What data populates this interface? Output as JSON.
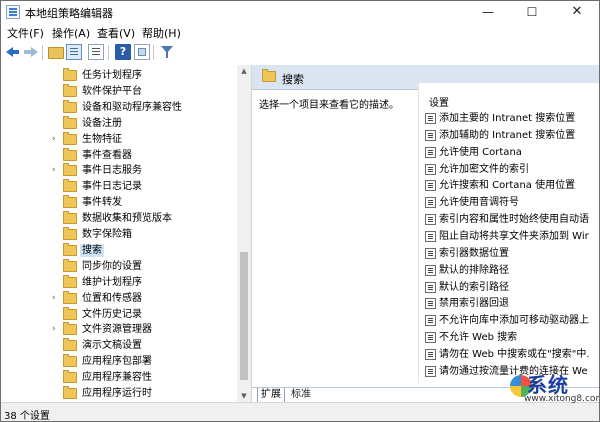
{
  "window": {
    "title": "本地组策略编辑器",
    "min_glyph": "—",
    "max_glyph": "☐",
    "close_glyph": "✕"
  },
  "menu": [
    "文件(F)",
    "操作(A)",
    "查看(V)",
    "帮助(H)"
  ],
  "toolbar": {
    "icons": [
      "back-arrow-icon",
      "forward-arrow-icon",
      "folder-up-icon",
      "show-hide-tree-icon",
      "list-icon",
      "help-icon",
      "properties-icon",
      "filter-icon"
    ],
    "help_glyph": "?"
  },
  "tree": {
    "items": [
      {
        "label": "任务计划程序",
        "expandable": false
      },
      {
        "label": "软件保护平台",
        "expandable": false
      },
      {
        "label": "设备和驱动程序兼容性",
        "expandable": false
      },
      {
        "label": "设备注册",
        "expandable": false
      },
      {
        "label": "生物特征",
        "expandable": true
      },
      {
        "label": "事件查看器",
        "expandable": false
      },
      {
        "label": "事件日志服务",
        "expandable": true
      },
      {
        "label": "事件日志记录",
        "expandable": false
      },
      {
        "label": "事件转发",
        "expandable": false
      },
      {
        "label": "数据收集和预览版本",
        "expandable": false
      },
      {
        "label": "数字保险箱",
        "expandable": false
      },
      {
        "label": "搜索",
        "expandable": false,
        "selected": true
      },
      {
        "label": "同步你的设置",
        "expandable": false
      },
      {
        "label": "维护计划程序",
        "expandable": false
      },
      {
        "label": "位置和传感器",
        "expandable": true
      },
      {
        "label": "文件历史记录",
        "expandable": false
      },
      {
        "label": "文件资源管理器",
        "expandable": true
      },
      {
        "label": "演示文稿设置",
        "expandable": false
      },
      {
        "label": "应用程序包部署",
        "expandable": false
      },
      {
        "label": "应用程序兼容性",
        "expandable": false
      },
      {
        "label": "应用程序运行时",
        "expandable": false
      }
    ],
    "expand_glyph": "›",
    "scroll_up_glyph": "▲",
    "scroll_down_glyph": "▼"
  },
  "detail": {
    "header_title": "搜索",
    "description": "选择一个项目来查看它的描述。",
    "settings_header": "设置",
    "settings": [
      "添加主要的 Intranet 搜索位置",
      "添加辅助的 Intranet 搜索位置",
      "允许使用 Cortana",
      "允许加密文件的索引",
      "允许搜索和 Cortana 使用位置",
      "允许使用音调符号",
      "索引内容和属性时始终使用自动语",
      "阻止自动将共享文件夹添加到 Wir",
      "索引器数据位置",
      "默认的排除路径",
      "默认的索引路径",
      "禁用索引器回退",
      "不允许向库中添加可移动驱动器上",
      "不允许 Web 搜索",
      "请勿在 Web 中搜索或在\"搜索\"中.",
      "请勿通过按流量计费的连接在 We"
    ],
    "tabs": [
      "扩展",
      "标准"
    ]
  },
  "status": {
    "text": "38 个设置"
  },
  "watermark": {
    "logo_text": "系统",
    "url": "www.xitong8.com"
  }
}
